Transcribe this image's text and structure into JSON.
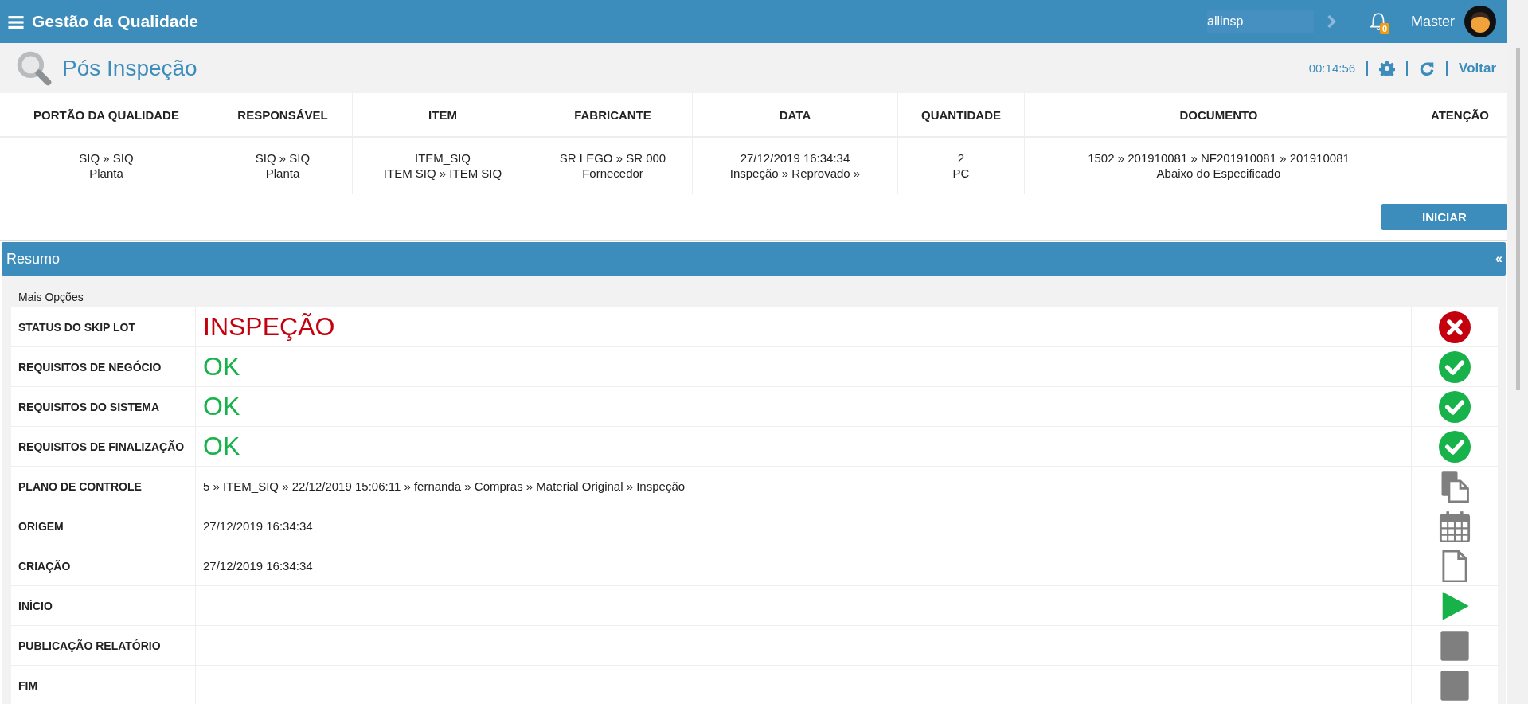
{
  "app": {
    "title": "Gestão da Qualidade",
    "search": {
      "value": "allinsp"
    },
    "notifications": {
      "count": "0"
    },
    "user": "Master"
  },
  "page": {
    "title": "Pós Inspeção",
    "timer": "00:14:56",
    "back": "Voltar"
  },
  "table": {
    "columns": [
      "PORTÃO DA QUALIDADE",
      "RESPONSÁVEL",
      "ITEM",
      "FABRICANTE",
      "DATA",
      "QUANTIDADE",
      "DOCUMENTO",
      "ATENÇÃO"
    ],
    "rows": [
      {
        "cells": [
          [
            "SIQ » SIQ",
            "Planta"
          ],
          [
            "SIQ » SIQ",
            "Planta"
          ],
          [
            "ITEM_SIQ",
            "ITEM SIQ » ITEM SIQ"
          ],
          [
            "SR LEGO » SR 000",
            "Fornecedor"
          ],
          [
            "27/12/2019 16:34:34",
            "Inspeção » Reprovado »"
          ],
          [
            "2",
            "PC"
          ],
          [
            "1502 » 201910081 » NF201910081 » 201910081",
            "Abaixo do Especificado"
          ]
        ]
      }
    ]
  },
  "start_button": "INICIAR",
  "summary": {
    "title": "Resumo",
    "collapse": "«",
    "options_label": "Mais Opções",
    "rows": [
      {
        "label": "STATUS DO SKIP LOT",
        "kind": "failed",
        "value": "INSPEÇÃO"
      },
      {
        "label": "REQUISITOS DE NEGÓCIO",
        "kind": "passed",
        "value": "OK"
      },
      {
        "label": "REQUISITOS DO SISTEMA",
        "kind": "passed",
        "value": "OK"
      },
      {
        "label": "REQUISITOS DE FINALIZAÇÃO",
        "kind": "passed",
        "value": "OK"
      },
      {
        "label": "PLANO DE CONTROLE",
        "kind": "documents",
        "value": "5 » ITEM_SIQ » 22/12/2019 15:06:11 » fernanda » Compras » Material Original » Inspeção"
      },
      {
        "label": "ORIGEM",
        "kind": "date",
        "value": "27/12/2019 16:34:34"
      },
      {
        "label": "CRIAÇÃO",
        "kind": "file",
        "value": "27/12/2019 16:34:34"
      },
      {
        "label": "INÍCIO",
        "kind": "start"
      },
      {
        "label": "PUBLICAÇÃO RELATÓRIO",
        "kind": "stop"
      },
      {
        "label": "FIM",
        "kind": "stop"
      }
    ]
  }
}
